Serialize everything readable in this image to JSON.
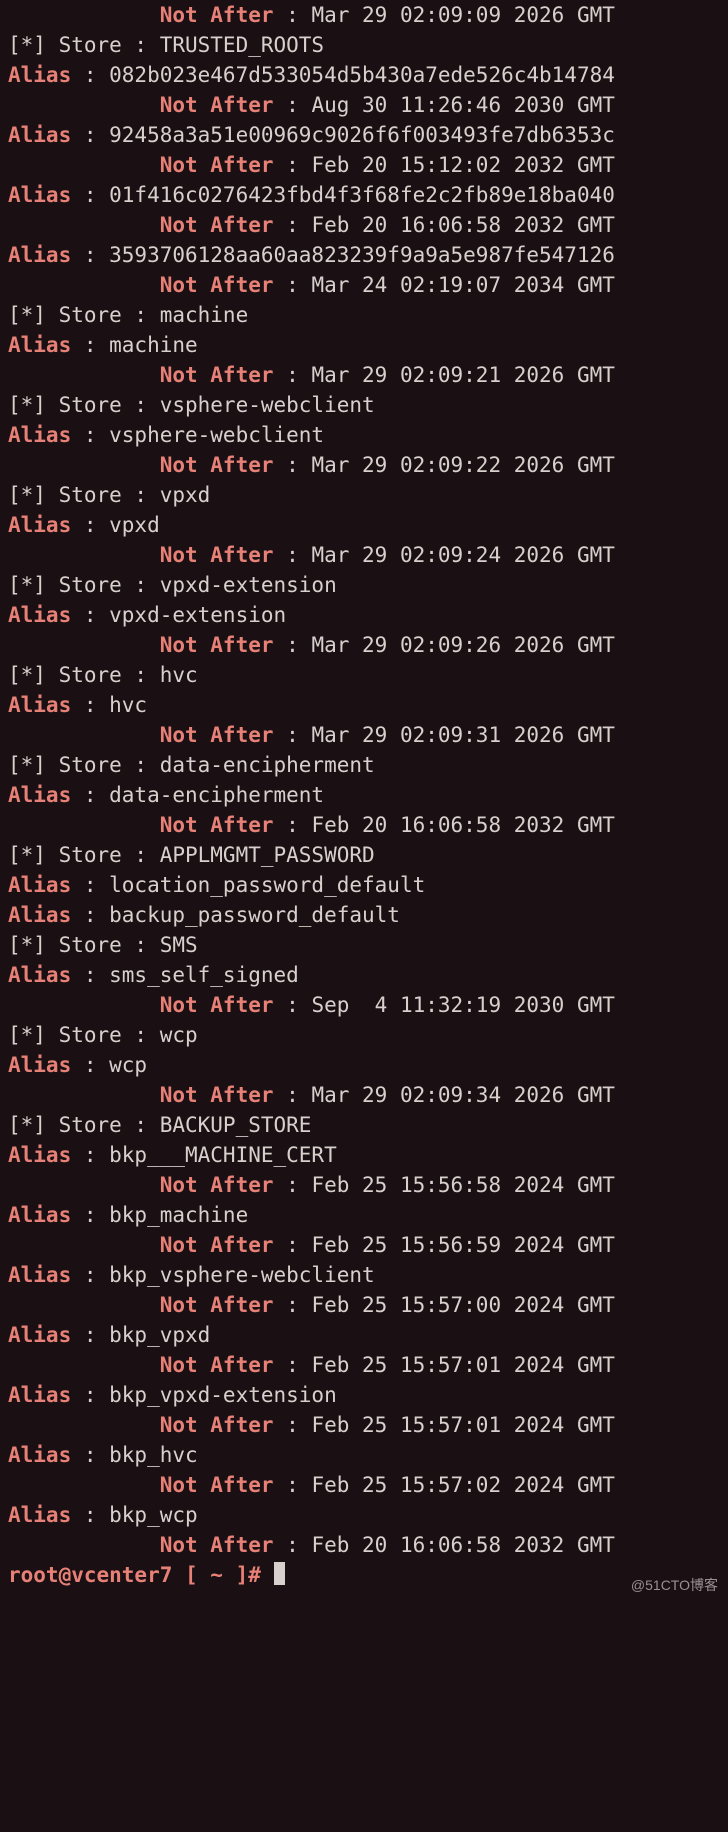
{
  "indent": "            ",
  "not_after_label": "Not After ",
  "store_label": "[*] Store : ",
  "alias_label": "Alias",
  "alias_sep": " : ",
  "colon_val_sep": ": ",
  "prompt_user": "root@vcenter7 [ ~ ]#",
  "prompt_space": " ",
  "watermark": "@51CTO博客",
  "lines": [
    {
      "t": "na",
      "val": "Mar 29 02:09:09 2026 GMT"
    },
    {
      "t": "store",
      "val": "TRUSTED_ROOTS"
    },
    {
      "t": "alias",
      "val": "082b023e467d533054d5b430a7ede526c4b14784"
    },
    {
      "t": "na",
      "val": "Aug 30 11:26:46 2030 GMT"
    },
    {
      "t": "alias",
      "val": "92458a3a51e00969c9026f6f003493fe7db6353c"
    },
    {
      "t": "na",
      "val": "Feb 20 15:12:02 2032 GMT"
    },
    {
      "t": "alias",
      "val": "01f416c0276423fbd4f3f68fe2c2fb89e18ba040"
    },
    {
      "t": "na",
      "val": "Feb 20 16:06:58 2032 GMT"
    },
    {
      "t": "alias",
      "val": "3593706128aa60aa823239f9a9a5e987fe547126"
    },
    {
      "t": "na",
      "val": "Mar 24 02:19:07 2034 GMT"
    },
    {
      "t": "store",
      "val": "machine"
    },
    {
      "t": "alias",
      "val": "machine"
    },
    {
      "t": "na",
      "val": "Mar 29 02:09:21 2026 GMT"
    },
    {
      "t": "store",
      "val": "vsphere-webclient"
    },
    {
      "t": "alias",
      "val": "vsphere-webclient"
    },
    {
      "t": "na",
      "val": "Mar 29 02:09:22 2026 GMT"
    },
    {
      "t": "store",
      "val": "vpxd"
    },
    {
      "t": "alias",
      "val": "vpxd"
    },
    {
      "t": "na",
      "val": "Mar 29 02:09:24 2026 GMT"
    },
    {
      "t": "store",
      "val": "vpxd-extension"
    },
    {
      "t": "alias",
      "val": "vpxd-extension"
    },
    {
      "t": "na",
      "val": "Mar 29 02:09:26 2026 GMT"
    },
    {
      "t": "store",
      "val": "hvc"
    },
    {
      "t": "alias",
      "val": "hvc"
    },
    {
      "t": "na",
      "val": "Mar 29 02:09:31 2026 GMT"
    },
    {
      "t": "store",
      "val": "data-encipherment"
    },
    {
      "t": "alias",
      "val": "data-encipherment"
    },
    {
      "t": "na",
      "val": "Feb 20 16:06:58 2032 GMT"
    },
    {
      "t": "store",
      "val": "APPLMGMT_PASSWORD"
    },
    {
      "t": "alias",
      "val": "location_password_default"
    },
    {
      "t": "alias",
      "val": "backup_password_default"
    },
    {
      "t": "store",
      "val": "SMS"
    },
    {
      "t": "alias",
      "val": "sms_self_signed"
    },
    {
      "t": "na",
      "val": "Sep  4 11:32:19 2030 GMT"
    },
    {
      "t": "store",
      "val": "wcp"
    },
    {
      "t": "alias",
      "val": "wcp"
    },
    {
      "t": "na",
      "val": "Mar 29 02:09:34 2026 GMT"
    },
    {
      "t": "store",
      "val": "BACKUP_STORE"
    },
    {
      "t": "alias",
      "val": "bkp___MACHINE_CERT"
    },
    {
      "t": "na",
      "val": "Feb 25 15:56:58 2024 GMT"
    },
    {
      "t": "alias",
      "val": "bkp_machine"
    },
    {
      "t": "na",
      "val": "Feb 25 15:56:59 2024 GMT"
    },
    {
      "t": "alias",
      "val": "bkp_vsphere-webclient"
    },
    {
      "t": "na",
      "val": "Feb 25 15:57:00 2024 GMT"
    },
    {
      "t": "alias",
      "val": "bkp_vpxd"
    },
    {
      "t": "na",
      "val": "Feb 25 15:57:01 2024 GMT"
    },
    {
      "t": "alias",
      "val": "bkp_vpxd-extension"
    },
    {
      "t": "na",
      "val": "Feb 25 15:57:01 2024 GMT"
    },
    {
      "t": "alias",
      "val": "bkp_hvc"
    },
    {
      "t": "na",
      "val": "Feb 25 15:57:02 2024 GMT"
    },
    {
      "t": "alias",
      "val": "bkp_wcp"
    },
    {
      "t": "na",
      "val": "Feb 20 16:06:58 2032 GMT"
    }
  ]
}
